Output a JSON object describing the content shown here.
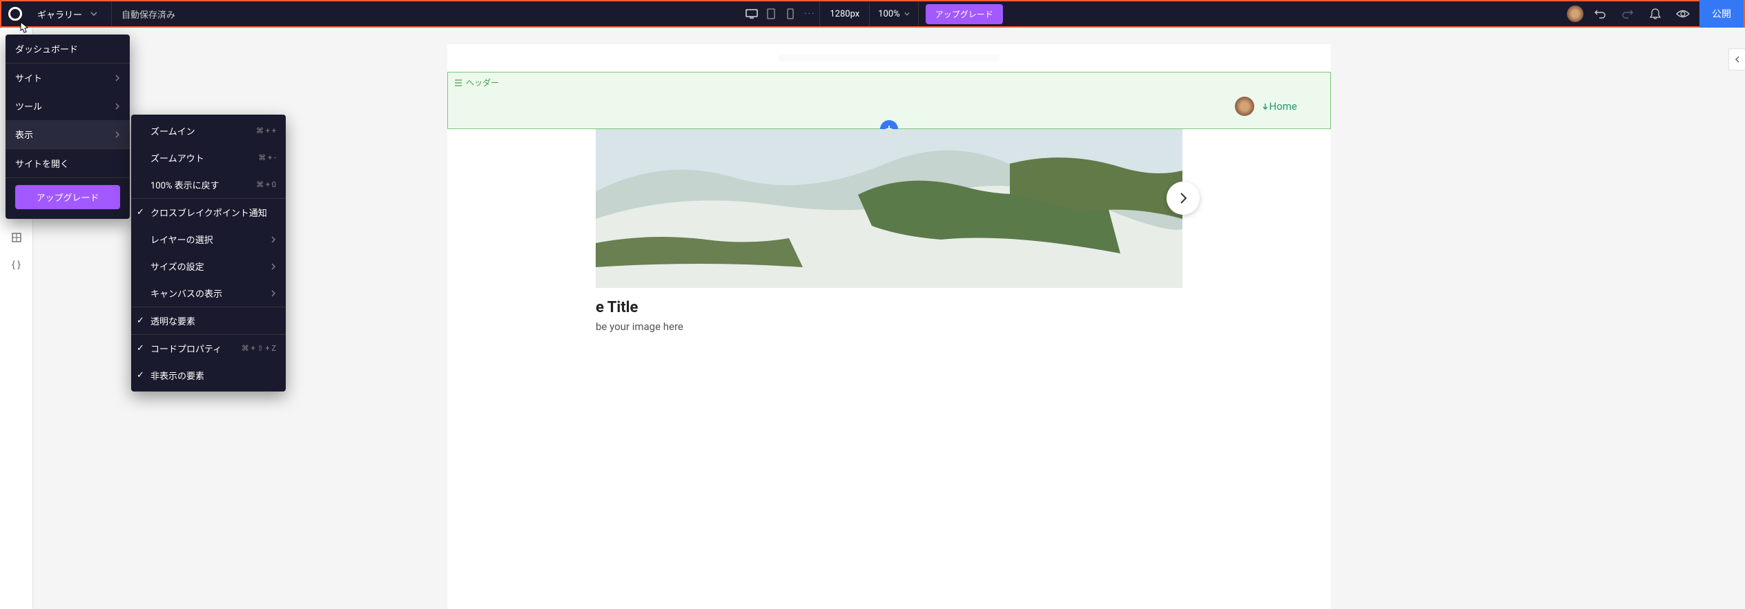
{
  "topbar": {
    "project_name": "ギャラリー",
    "save_status": "自動保存済み",
    "width_label": "1280px",
    "zoom_label": "100%",
    "upgrade_label": "アップグレード",
    "publish_label": "公開"
  },
  "menu": {
    "items": [
      {
        "label": "ダッシュボード",
        "has_sub": false
      },
      {
        "label": "サイト",
        "has_sub": true
      },
      {
        "label": "ツール",
        "has_sub": true
      },
      {
        "label": "表示",
        "has_sub": true,
        "hover": true
      },
      {
        "label": "サイトを開く",
        "has_sub": false
      }
    ],
    "upgrade_label": "アップグレード"
  },
  "submenu": {
    "items": [
      {
        "label": "ズームイン",
        "shortcut": "⌘ + +",
        "check": false,
        "has_sub": false
      },
      {
        "label": "ズームアウト",
        "shortcut": "⌘ + -",
        "check": false,
        "has_sub": false
      },
      {
        "label": "100% 表示に戻す",
        "shortcut": "⌘ + 0",
        "check": false,
        "has_sub": false
      },
      {
        "sep": true
      },
      {
        "label": "クロスブレイクポイント通知",
        "shortcut": "",
        "check": true,
        "has_sub": false
      },
      {
        "label": "レイヤーの選択",
        "shortcut": "",
        "check": false,
        "has_sub": true
      },
      {
        "label": "サイズの設定",
        "shortcut": "",
        "check": false,
        "has_sub": true
      },
      {
        "label": "キャンバスの表示",
        "shortcut": "",
        "check": false,
        "has_sub": true
      },
      {
        "sep": true
      },
      {
        "label": "透明な要素",
        "shortcut": "",
        "check": true,
        "has_sub": false
      },
      {
        "sep": true
      },
      {
        "label": "コードプロパティ",
        "shortcut": "⌘ + ⇧ + Z",
        "check": true,
        "has_sub": false
      },
      {
        "label": "非表示の要素",
        "shortcut": "",
        "check": true,
        "has_sub": false
      }
    ]
  },
  "canvas": {
    "header_tag": "ヘッダー",
    "nav_home": "Home",
    "hero_title_suffix": "e Title",
    "hero_desc_suffix": "be your image here"
  }
}
